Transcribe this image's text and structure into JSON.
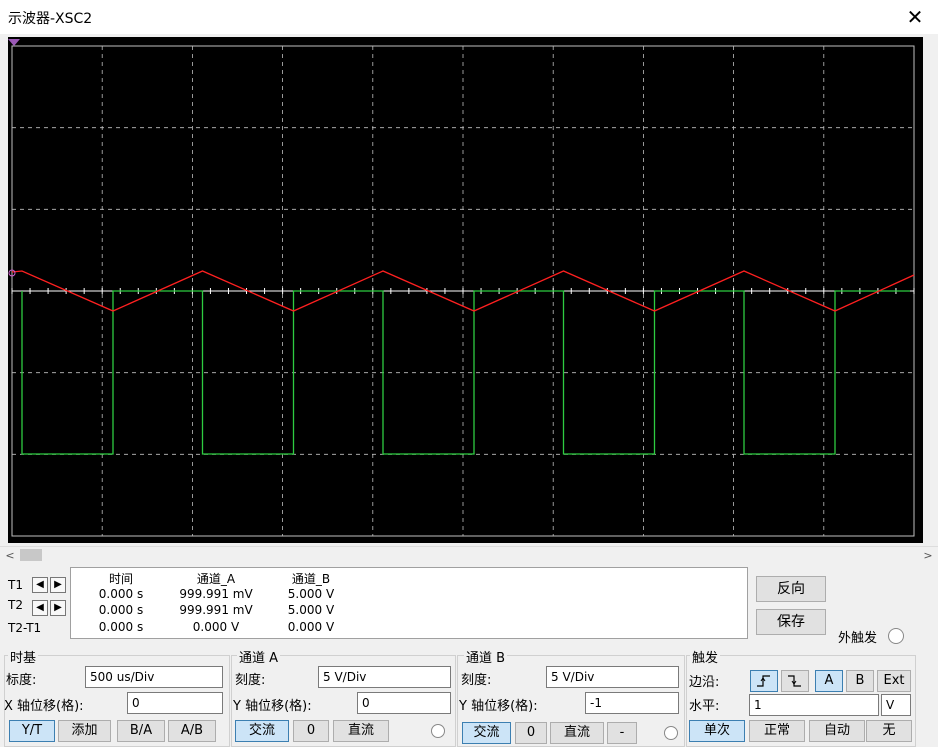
{
  "window": {
    "title": "示波器-XSC2",
    "close": "✕"
  },
  "screen": {
    "bg": "#000000",
    "grid_color": "#bfbfbf",
    "channel_a_color": "#ff2020",
    "channel_b_color": "#2ecc40",
    "marker_t1": "T1 marker"
  },
  "scrollbar": {
    "left": "<",
    "right": ">"
  },
  "readout": {
    "headers": [
      "时间",
      "通道_A",
      "通道_B"
    ],
    "rows": [
      {
        "label": "T1",
        "time": "0.000 s",
        "a": "999.991 mV",
        "b": "5.000 V"
      },
      {
        "label": "T2",
        "time": "0.000 s",
        "a": "999.991 mV",
        "b": "5.000 V"
      },
      {
        "label": "T2-T1",
        "time": "0.000 s",
        "a": "0.000 V",
        "b": "0.000 V"
      }
    ]
  },
  "side": {
    "reverse": "反向",
    "save": "保存",
    "ext_trigger": "外触发"
  },
  "timebase": {
    "title": "时基",
    "scale_label": "标度:",
    "scale": "500 us/Div",
    "xpos_label": "X 轴位移(格):",
    "xpos": "0",
    "buttons": [
      "Y/T",
      "添加",
      "B/A",
      "A/B"
    ]
  },
  "channel_a": {
    "title": "通道 A",
    "scale_label": "刻度:",
    "scale": "5  V/Div",
    "ypos_label": "Y 轴位移(格):",
    "ypos": "0",
    "buttons": [
      "交流",
      "0",
      "直流"
    ]
  },
  "channel_b": {
    "title": "通道 B",
    "scale_label": "刻度:",
    "scale": "5  V/Div",
    "ypos_label": "Y 轴位移(格):",
    "ypos": "-1",
    "buttons": [
      "交流",
      "0",
      "直流",
      "-"
    ]
  },
  "trigger": {
    "title": "触发",
    "edge_label": "边沿:",
    "level_label": "水平:",
    "level": "1",
    "level_unit": "V",
    "source_buttons": [
      "A",
      "B",
      "Ext"
    ],
    "mode_buttons": [
      "单次",
      "正常",
      "自动",
      "无"
    ]
  }
}
